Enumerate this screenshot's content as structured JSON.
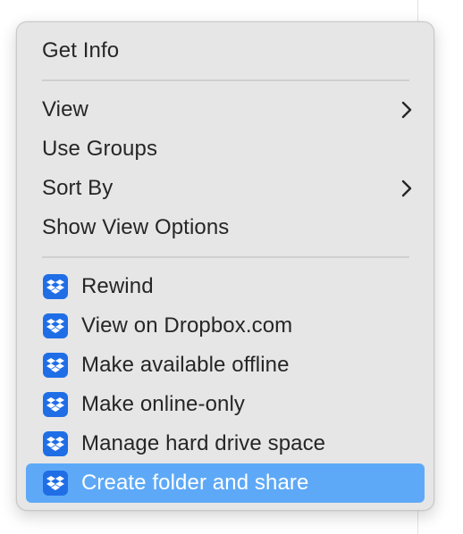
{
  "menu": {
    "get_info": "Get Info",
    "view": "View",
    "use_groups": "Use Groups",
    "sort_by": "Sort By",
    "show_view_options": "Show View Options",
    "dropbox_items": [
      "Rewind",
      "View on Dropbox.com",
      "Make available offline",
      "Make online-only",
      "Manage hard drive space",
      "Create folder and share"
    ],
    "highlighted_item": "Create folder and share",
    "icons": {
      "submenu": "chevron-right-icon",
      "dropbox": "dropbox-icon"
    },
    "colors": {
      "menu_bg": "#e6e6e6",
      "highlight": "#5ea9f7",
      "dropbox_blue": "#1f6ee6"
    }
  }
}
